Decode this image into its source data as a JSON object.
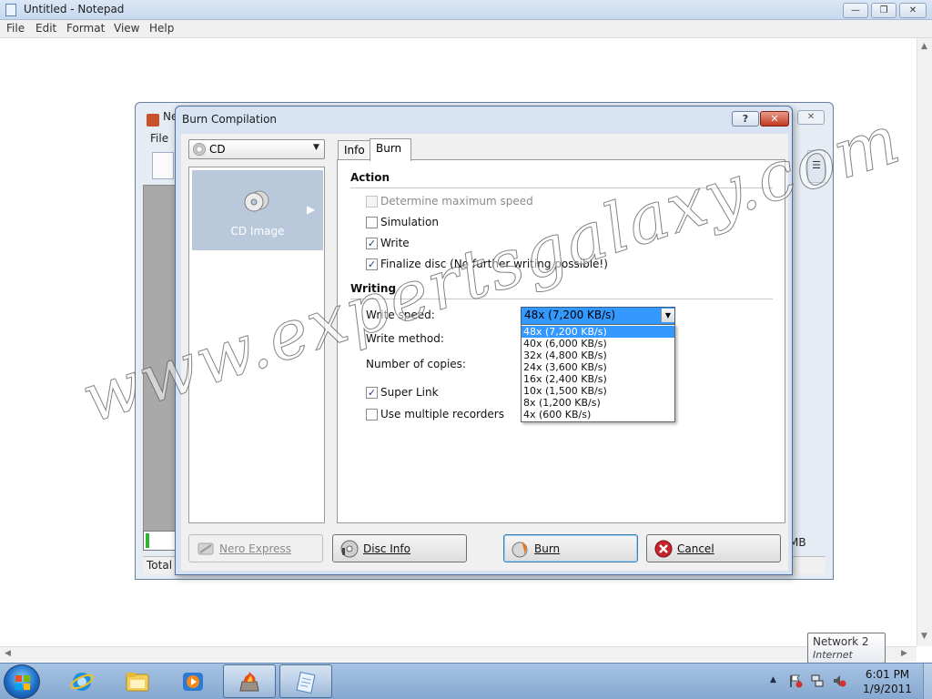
{
  "notepad": {
    "title": "Untitled - Notepad",
    "menu": [
      "File",
      "Edit",
      "Format",
      "View",
      "Help"
    ]
  },
  "nero_window": {
    "title_fragment": "Ne",
    "file_menu": "File",
    "mb_fragment": "MB",
    "total_fragment": "Total s",
    "progress": 0.1
  },
  "dialog": {
    "title": "Burn Compilation",
    "help_label": "?",
    "close_label": "✕",
    "disc_type": "CD",
    "left_tile_label": "CD Image",
    "tabs": [
      "Info",
      "Burn"
    ],
    "active_tab": "Burn",
    "action_section": "Action",
    "action_options": [
      {
        "label": "Determine maximum speed",
        "checked": false,
        "disabled": true
      },
      {
        "label": "Simulation",
        "checked": false,
        "disabled": false
      },
      {
        "label": "Write",
        "checked": true,
        "disabled": false
      },
      {
        "label": "Finalize disc (No further writing possible!)",
        "checked": true,
        "disabled": false
      }
    ],
    "writing_section": "Writing",
    "write_speed_label": "Write speed:",
    "write_method_label": "Write method:",
    "copies_label": "Number of copies:",
    "write_speed_value": "48x (7,200 KB/s)",
    "write_speed_options": [
      "48x (7,200 KB/s)",
      "40x (6,000 KB/s)",
      "32x (4,800 KB/s)",
      "24x (3,600 KB/s)",
      "16x (2,400 KB/s)",
      "10x (1,500 KB/s)",
      "8x (1,200 KB/s)",
      "4x (600 KB/s)"
    ],
    "writing_options": [
      {
        "label": "Super Link",
        "checked": true
      },
      {
        "label": "Use multiple recorders",
        "checked": false
      }
    ],
    "buttons": {
      "nero_express": "Nero Express",
      "disc_info": "Disc Info",
      "burn": "Burn",
      "cancel": "Cancel"
    }
  },
  "watermark": "www.expertsgalaxy.com",
  "network_tooltip": {
    "name": "Network  2",
    "status": "Internet access"
  },
  "taskbar": {
    "time": "6:01 PM",
    "date": "1/9/2011",
    "icons": [
      "internet-explorer-icon",
      "windows-explorer-icon",
      "media-player-icon",
      "nero-icon",
      "notepad-icon"
    ]
  },
  "colors": {
    "selection": "#3399ff",
    "taskbar": "#95b6db",
    "tile": "#b9c8db",
    "cancel_red": "#c8232c"
  }
}
